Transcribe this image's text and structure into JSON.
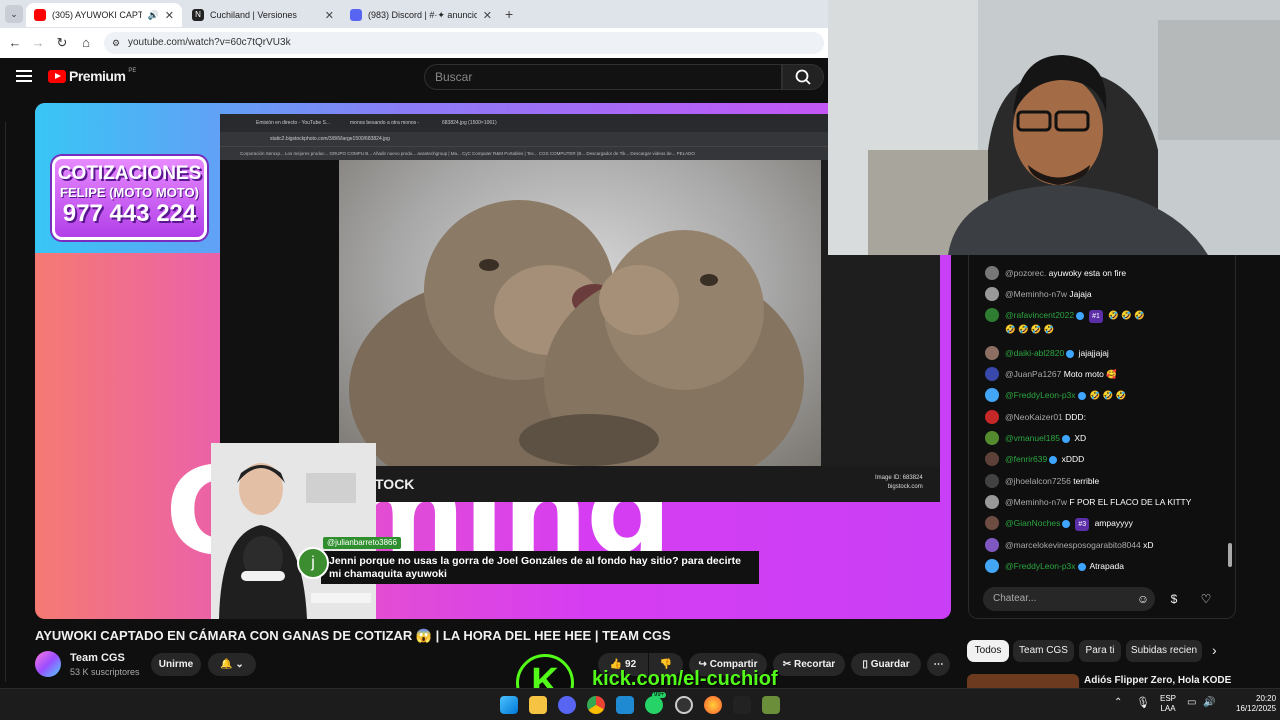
{
  "browser": {
    "tabs": [
      {
        "label": "(305) AYUWOKI CAPTADO E",
        "active": true,
        "color": "#ff0000"
      },
      {
        "label": "Cuchiland | Versiones",
        "active": false,
        "color": "#222222"
      },
      {
        "label": "(983) Discord | #·✦ anuncios",
        "active": false,
        "color": "#e53935"
      }
    ],
    "url": "youtube.com/watch?v=60c7tQrVU3k"
  },
  "youtube": {
    "logo_text": "Premium",
    "region": "PE",
    "search_placeholder": "Buscar"
  },
  "video": {
    "promo_line1": "COTIZACIONES",
    "promo_line2": "FELIPE (MOTO MOTO)",
    "promo_line3": "977 443 224",
    "photo_logo": "TOCK",
    "photo_meta_line1": "Image ID: 683824",
    "photo_meta_line2": "bigstock.com",
    "embedded_url": "static2.bigstockphoto.com/3/8/6/large1500/683824.jpg",
    "embedded_tabs": [
      "Emisión en directo - YouTube S...",
      "monos besando a otra monos -",
      "683824.jpg (1500×1061)"
    ],
    "embedded_bookmarks": "Corporación Seroxp...   Los mejores produc...   GRUPO COMPU B...   Añadir nuevo produ...   avantechgroup | Ma...   CyC Computer   R&M Portables | Tec...   CGS COMPUTER (B...   Descargador de Tik...   Descargar videos de...   PELADO",
    "overlay_user": "@julianbarreto3866",
    "overlay_initial": "j",
    "overlay_message": "Jenni porque no usas la gorra de Joel Gonzáles de al fondo hay sitio? para decirte mi chamaquita ayuwoki",
    "bg_text": "Gaming"
  },
  "meta": {
    "title": "AYUWOKI CAPTADO EN CÁMARA CON GANAS DE COTIZAR 😱 | LA HORA DEL HEE HEE | TEAM CGS",
    "channel": "Team CGS",
    "subscribers": "53 K suscriptores",
    "join_label": "Unirme",
    "likes": "92",
    "share_label": "Compartir",
    "clip_label": "Recortar",
    "save_label": "Guardar"
  },
  "chat": {
    "messages": [
      {
        "user": "@pozorec.",
        "text": "ayuwoky esta on fire",
        "member": false,
        "avatar_color": "#777777"
      },
      {
        "user": "@Meminho-n7w",
        "text": "Jajaja",
        "member": false,
        "avatar_color": "#999999"
      },
      {
        "user": "@rafavincent2022",
        "text": "🤣 🤣 🤣",
        "badge": "#1",
        "member": true,
        "avatar_color": "#2e7d32",
        "line2": "🤣 🤣 🤣 🤣"
      },
      {
        "user": "@daiki-abl2820",
        "text": "jajajjajaj",
        "member": true,
        "avatar_color": "#8d6e63"
      },
      {
        "user": "@JuanPa1267",
        "text": "Moto moto 🥰",
        "member": false,
        "avatar_color": "#3949ab"
      },
      {
        "user": "@FreddyLeon-p3x",
        "text": "🤣 🤣 🤣",
        "member": true,
        "avatar_color": "#42a5f5"
      },
      {
        "user": "@NeoKaizer01",
        "text": "DDD:",
        "member": false,
        "avatar_color": "#c62828"
      },
      {
        "user": "@vmanuel185",
        "text": "XD",
        "member": true,
        "avatar_color": "#558b2f"
      },
      {
        "user": "@fenrir639",
        "text": "xDDD",
        "member": true,
        "avatar_color": "#5d4037"
      },
      {
        "user": "@jhoelalcon7256",
        "text": "terrible",
        "member": false,
        "avatar_color": "#424242"
      },
      {
        "user": "@Meminho-n7w",
        "text": "F POR EL FLACO DE LA KITTY",
        "member": false,
        "avatar_color": "#999999"
      },
      {
        "user": "@GianNoches",
        "text": "ampayyyy",
        "badge": "#3",
        "member": true,
        "avatar_color": "#6d4c41"
      },
      {
        "user": "@marcelokevinesposogarabito8044",
        "text": "xD",
        "member": false,
        "avatar_color": "#7e57c2"
      },
      {
        "user": "@FreddyLeon-p3x",
        "text": "Atrapada",
        "member": true,
        "avatar_color": "#42a5f5"
      }
    ],
    "input_placeholder": "Chatear..."
  },
  "chips": [
    "Todos",
    "Team CGS",
    "Para ti",
    "Subidas recien"
  ],
  "related": {
    "title": "Adiós Flipper Zero, Hola KODE"
  },
  "kick": {
    "logo": "K",
    "url": "kick.com/el-cuchiof"
  },
  "taskbar": {
    "lang_line1": "ESP",
    "lang_line2": "LAA",
    "time": "20:20",
    "date": "16/12/2025",
    "whatsapp_badge": "99+"
  },
  "colors": {
    "kick_green": "#53fc18",
    "yt_red": "#ff0000",
    "member_green": "#2ba640"
  }
}
